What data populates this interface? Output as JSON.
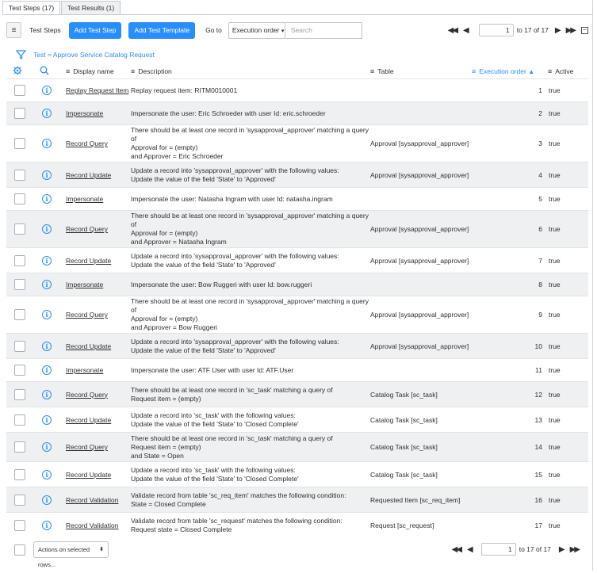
{
  "tabs": [
    {
      "label": "Test Steps (17)"
    },
    {
      "label": "Test Results (1)"
    }
  ],
  "toolbar": {
    "title": "Test Steps",
    "add_step": "Add Test Step",
    "add_template": "Add Test Template",
    "goto_label": "Go to",
    "goto_select": "Execution order",
    "search_placeholder": "Search"
  },
  "pager": {
    "page": "1",
    "to_text": "to 17 of 17"
  },
  "filter": {
    "text": "Test = Approve Service Catalog Request"
  },
  "columns": {
    "display_name": "Display name",
    "description": "Description",
    "table": "Table",
    "execution_order": "Execution order",
    "active": "Active"
  },
  "rows": [
    {
      "name": "Replay Request Item",
      "desc": "Replay request item: RITM0010001",
      "table": "",
      "order": "1",
      "active": "true"
    },
    {
      "name": "Impersonate",
      "desc": "Impersonate the user: Eric Schroeder with user Id: eric.schroeder",
      "table": "",
      "order": "2",
      "active": "true"
    },
    {
      "name": "Record Query",
      "desc": "There should be at least one record in 'sysapproval_approver' matching a query of\nApproval for = (empty)\nand Approver = Eric Schroeder",
      "table": "Approval [sysapproval_approver]",
      "order": "3",
      "active": "true"
    },
    {
      "name": "Record Update",
      "desc": "Update a record into 'sysapproval_approver' with the following values:\nUpdate the value of the field 'State' to 'Approved'",
      "table": "Approval [sysapproval_approver]",
      "order": "4",
      "active": "true"
    },
    {
      "name": "Impersonate",
      "desc": "Impersonate the user: Natasha Ingram with user Id: natasha.ingram",
      "table": "",
      "order": "5",
      "active": "true"
    },
    {
      "name": "Record Query",
      "desc": "There should be at least one record in 'sysapproval_approver' matching a query of\nApproval for = (empty)\nand Approver = Natasha Ingram",
      "table": "Approval [sysapproval_approver]",
      "order": "6",
      "active": "true"
    },
    {
      "name": "Record Update",
      "desc": "Update a record into 'sysapproval_approver' with the following values:\nUpdate the value of the field 'State' to 'Approved'",
      "table": "Approval [sysapproval_approver]",
      "order": "7",
      "active": "true"
    },
    {
      "name": "Impersonate",
      "desc": "Impersonate the user: Bow Ruggeri with user Id: bow.ruggeri",
      "table": "",
      "order": "8",
      "active": "true"
    },
    {
      "name": "Record Query",
      "desc": "There should be at least one record in 'sysapproval_approver' matching a query of\nApproval for = (empty)\nand Approver = Bow Ruggeri",
      "table": "Approval [sysapproval_approver]",
      "order": "9",
      "active": "true"
    },
    {
      "name": "Record Update",
      "desc": "Update a record into 'sysapproval_approver' with the following values:\nUpdate the value of the field 'State' to 'Approved'",
      "table": "Approval [sysapproval_approver]",
      "order": "10",
      "active": "true"
    },
    {
      "name": "Impersonate",
      "desc": "Impersonate the user: ATF User with user Id: ATF.User",
      "table": "",
      "order": "11",
      "active": "true"
    },
    {
      "name": "Record Query",
      "desc": "There should be at least one record in 'sc_task' matching a query of\nRequest item = (empty)",
      "table": "Catalog Task [sc_task]",
      "order": "12",
      "active": "true"
    },
    {
      "name": "Record Update",
      "desc": "Update a record into 'sc_task' with the following values:\nUpdate the value of the field 'State' to 'Closed Complete'",
      "table": "Catalog Task [sc_task]",
      "order": "13",
      "active": "true"
    },
    {
      "name": "Record Query",
      "desc": "There should be at least one record in 'sc_task' matching a query of\nRequest item = (empty)\nand State = Open",
      "table": "Catalog Task [sc_task]",
      "order": "14",
      "active": "true"
    },
    {
      "name": "Record Update",
      "desc": "Update a record into 'sc_task' with the following values:\nUpdate the value of the field 'State' to 'Closed Complete'",
      "table": "Catalog Task [sc_task]",
      "order": "15",
      "active": "true"
    },
    {
      "name": "Record Validation",
      "desc": "Validate record from table 'sc_req_item' matches the following condition:\nState = Closed Complete",
      "table": "Requested Item [sc_req_item]",
      "order": "16",
      "active": "true"
    },
    {
      "name": "Record Validation",
      "desc": "Validate record from table 'sc_request' matches the following condition:\nRequest state = Closed Complete",
      "table": "Request [sc_request]",
      "order": "17",
      "active": "true"
    }
  ],
  "footer": {
    "actions": "Actions on selected rows..."
  },
  "colors": {
    "accent": "#278efc",
    "row_alt": "#eef0f2"
  }
}
